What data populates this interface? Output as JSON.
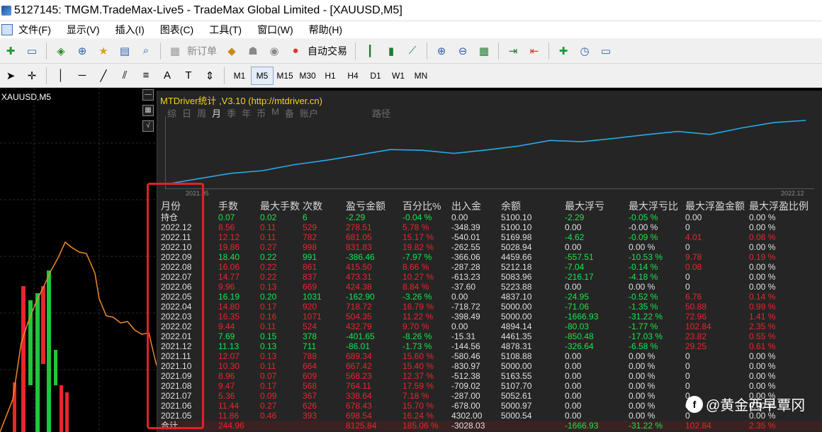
{
  "window": {
    "title": "5127145: TMGM.TradeMax-Live5 - TradeMax Global Limited - [XAUUSD,M5]"
  },
  "menu": [
    "文件(F)",
    "显示(V)",
    "插入(I)",
    "图表(C)",
    "工具(T)",
    "窗口(W)",
    "帮助(H)"
  ],
  "toolbar": {
    "new_order": "新订单",
    "auto_trade": "自动交易"
  },
  "timeframes": [
    "M1",
    "M5",
    "M15",
    "M30",
    "H1",
    "H4",
    "D1",
    "W1",
    "MN"
  ],
  "active_timeframe": "M5",
  "chart": {
    "symbol": "XAUUSD,M5"
  },
  "panel": {
    "title": "MTDriver统计 ,V3.10 (http://mtdriver.cn)",
    "tabs": [
      "综",
      "日",
      "周",
      "月",
      "季",
      "年",
      "币",
      "M",
      "备",
      "账户",
      "路径"
    ],
    "active_tab": "月",
    "date_start": "2021.05",
    "date_end": "2022.12"
  },
  "balance_curve": [
    5000.97,
    5000.0,
    5002.61,
    5052.61,
    5107.7,
    5163.55,
    5000.0,
    5108.88,
    4878.31,
    4461.35,
    4894.14,
    5000.0,
    5000.0,
    4837.1,
    5223.88,
    5083.96,
    5212.18,
    4459.66,
    5028.94,
    5169.98,
    5100.1
  ],
  "table": {
    "headers": [
      "月份",
      "手数",
      "最大手数",
      "次数",
      "盈亏金额",
      "百分比%",
      "出入金",
      "余额",
      "最大浮亏",
      "最大浮亏比",
      "最大浮盈金额",
      "最大浮盈比例"
    ],
    "rows": [
      {
        "c": [
          "持仓",
          "0.07",
          "0.02",
          "6",
          "-2.29",
          "-0.04 %",
          "0.00",
          "5100.10",
          "-2.29",
          "-0.05 %",
          "0.00",
          "0.00 %"
        ],
        "k": "g"
      },
      {
        "c": [
          "2022.12",
          "8.56",
          "0.11",
          "529",
          "278.51",
          "5.78 %",
          "-348.39",
          "5100.10",
          "0.00",
          "-0.00 %",
          "0",
          "0.00 %"
        ],
        "k": "r"
      },
      {
        "c": [
          "2022.11",
          "12.12",
          "0.11",
          "782",
          "681.05",
          "15.17 %",
          "-540.01",
          "5169.98",
          "-4.62",
          "-0.09 %",
          "4.01",
          "0.08 %"
        ],
        "k": "r"
      },
      {
        "c": [
          "2022.10",
          "19.86",
          "0.27",
          "998",
          "831.83",
          "19.82 %",
          "-262.55",
          "5028.94",
          "0.00",
          "0.00 %",
          "0",
          "0.00 %"
        ],
        "k": "r"
      },
      {
        "c": [
          "2022.09",
          "18.40",
          "0.22",
          "991",
          "-386.46",
          "-7.97 %",
          "-366.06",
          "4459.66",
          "-557.51",
          "-10.53 %",
          "9.78",
          "0.19 %"
        ],
        "k": "g"
      },
      {
        "c": [
          "2022.08",
          "16.06",
          "0.22",
          "861",
          "415.50",
          "8.66 %",
          "-287.28",
          "5212.18",
          "-7.04",
          "-0.14 %",
          "0.08",
          "0.00 %"
        ],
        "k": "r"
      },
      {
        "c": [
          "2022.07",
          "14.77",
          "0.22",
          "837",
          "473.31",
          "10.27 %",
          "-613.23",
          "5083.96",
          "-216.17",
          "-4.18 %",
          "0",
          "0.00 %"
        ],
        "k": "r"
      },
      {
        "c": [
          "2022.06",
          "9.96",
          "0.13",
          "669",
          "424.38",
          "8.84 %",
          "-37.60",
          "5223.88",
          "0.00",
          "0.00 %",
          "0",
          "0.00 %"
        ],
        "k": "r"
      },
      {
        "c": [
          "2022.05",
          "16.19",
          "0.20",
          "1031",
          "-162.90",
          "-3.26 %",
          "0.00",
          "4837.10",
          "-24.95",
          "-0.52 %",
          "6.76",
          "0.14 %"
        ],
        "k": "g"
      },
      {
        "c": [
          "2022.04",
          "14.80",
          "0.17",
          "920",
          "718.72",
          "16.79 %",
          "-718.72",
          "5000.00",
          "-71.06",
          "-1.35 %",
          "50.88",
          "0.99 %"
        ],
        "k": "r"
      },
      {
        "c": [
          "2022.03",
          "16.35",
          "0.16",
          "1071",
          "504.35",
          "11.22 %",
          "-398.49",
          "5000.00",
          "-1666.93",
          "-31.22 %",
          "72.96",
          "1.41 %"
        ],
        "k": "r"
      },
      {
        "c": [
          "2022.02",
          "9.44",
          "0.11",
          "524",
          "432.79",
          "9.70 %",
          "0.00",
          "4894.14",
          "-80.03",
          "-1.77 %",
          "102.84",
          "2.35 %"
        ],
        "k": "r"
      },
      {
        "c": [
          "2022.01",
          "7.69",
          "0.15",
          "378",
          "-401.65",
          "-8.26 %",
          "-15.31",
          "4461.35",
          "-850.48",
          "-17.03 %",
          "23.82",
          "0.55 %"
        ],
        "k": "g"
      },
      {
        "c": [
          "2021.12",
          "11.13",
          "0.13",
          "711",
          "-86.01",
          "-1.73 %",
          "-144.56",
          "4878.31",
          "-326.64",
          "-6.58 %",
          "29.25",
          "0.61 %"
        ],
        "k": "g"
      },
      {
        "c": [
          "2021.11",
          "12.07",
          "0.13",
          "788",
          "689.34",
          "15.60 %",
          "-580.46",
          "5108.88",
          "0.00",
          "0.00 %",
          "0",
          "0.00 %"
        ],
        "k": "r"
      },
      {
        "c": [
          "2021.10",
          "10.30",
          "0.11",
          "664",
          "667.42",
          "15.40 %",
          "-830.97",
          "5000.00",
          "0.00",
          "0.00 %",
          "0",
          "0.00 %"
        ],
        "k": "r"
      },
      {
        "c": [
          "2021.09",
          "8.96",
          "0.07",
          "609",
          "568.23",
          "12.37 %",
          "-512.38",
          "5163.55",
          "0.00",
          "0.00 %",
          "0",
          "0.00 %"
        ],
        "k": "r"
      },
      {
        "c": [
          "2021.08",
          "9.47",
          "0.17",
          "568",
          "764.11",
          "17.59 %",
          "-709.02",
          "5107.70",
          "0.00",
          "0.00 %",
          "0",
          "0.00 %"
        ],
        "k": "r"
      },
      {
        "c": [
          "2021.07",
          "5.36",
          "0.09",
          "367",
          "338.64",
          "7.18 %",
          "-287.00",
          "5052.61",
          "0.00",
          "0.00 %",
          "0",
          "0.00 %"
        ],
        "k": "r"
      },
      {
        "c": [
          "2021.06",
          "11.44",
          "0.27",
          "626",
          "678.43",
          "15.70 %",
          "-678.00",
          "5000.97",
          "0.00",
          "0.00 %",
          "0",
          "0.00 %"
        ],
        "k": "r"
      },
      {
        "c": [
          "2021.05",
          "11.86",
          "0.46",
          "393",
          "698.54",
          "16.24 %",
          "4302.00",
          "5000.54",
          "0.00",
          "0.00 %",
          "0",
          "0.00 %"
        ],
        "k": "r"
      },
      {
        "c": [
          "合计",
          "244.96",
          "",
          "",
          "8125.84",
          "185.06 %",
          "-3028.03",
          "",
          "-1666.93",
          "-31.22 %",
          "102.84",
          "2.35 %"
        ],
        "k": "r"
      }
    ]
  },
  "watermark": {
    "text": "@黄金西早覃冈"
  },
  "colors": {
    "positive": "#e8262c",
    "negative": "#19e64a",
    "title": "#f2d21b",
    "curve": "#2aa8e8",
    "highlight_box": "#e2202a",
    "price_line": "#f0892a"
  }
}
